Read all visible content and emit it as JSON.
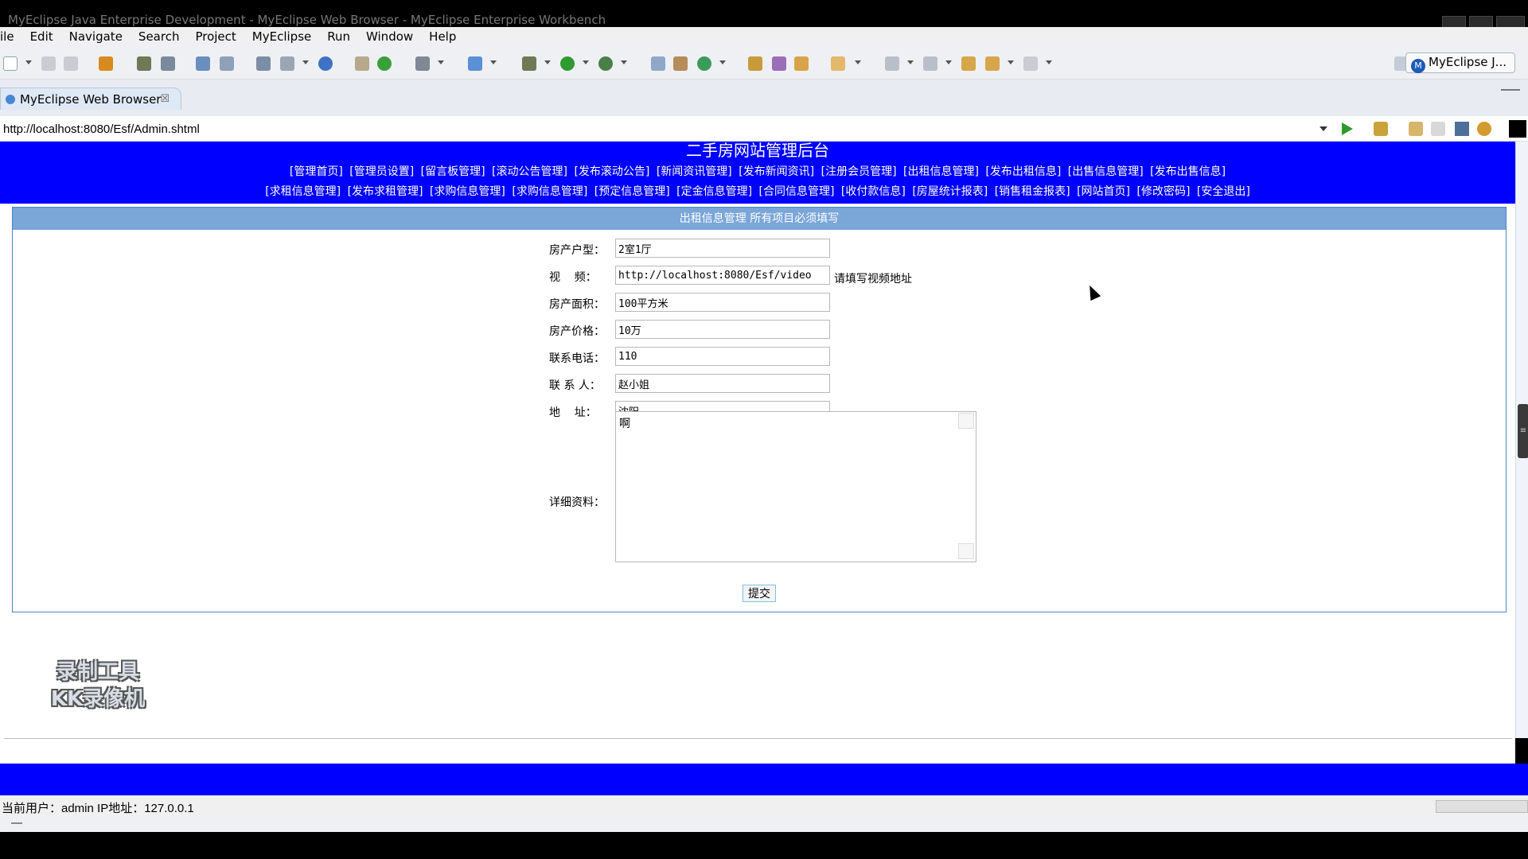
{
  "window": {
    "title": "MyEclipse Java Enterprise Development - MyEclipse Web Browser - MyEclipse Enterprise Workbench"
  },
  "menu": {
    "items": [
      "ile",
      "Edit",
      "Navigate",
      "Search",
      "Project",
      "MyEclipse",
      "Run",
      "Window",
      "Help"
    ]
  },
  "toolbar": {
    "perspective_label": "MyEclipse J..."
  },
  "editor_tab": {
    "label": "MyEclipse Web Browser",
    "close": "☒"
  },
  "address": {
    "url": "http://localhost:8080/Esf/Admin.shtml"
  },
  "site": {
    "title": "二手房网站管理后台",
    "nav_row1": [
      "[管理首页]",
      "[管理员设置]",
      "[留言板管理]",
      "[滚动公告管理]",
      "[发布滚动公告]",
      "[新闻资讯管理]",
      "[发布新闻资讯]",
      "[注册会员管理]",
      "[出租信息管理]",
      "[发布出租信息]",
      "[出售信息管理]",
      "[发布出售信息]"
    ],
    "nav_row2": [
      "[求租信息管理]",
      "[发布求租管理]",
      "[求购信息管理]",
      "[求购信息管理]",
      "[预定信息管理]",
      "[定金信息管理]",
      "[合同信息管理]",
      "[收付款信息]",
      "[房屋统计报表]",
      "[销售租金报表]",
      "[网站首页]",
      "[修改密码]",
      "[安全退出]"
    ]
  },
  "form": {
    "header": "出租信息管理 所有项目必须填写",
    "fields": [
      {
        "label": "房产户型：",
        "value": "2室1厅"
      },
      {
        "label": "视    频：",
        "value": "http://localhost:8080/Esf/video",
        "hint": "请填写视频地址"
      },
      {
        "label": "房产面积：",
        "value": "100平方米"
      },
      {
        "label": "房产价格：",
        "value": "10万"
      },
      {
        "label": "联系电话：",
        "value": "110"
      },
      {
        "label": "联 系 人：",
        "value": "赵小姐"
      },
      {
        "label": "地    址：",
        "value": "沈阳"
      }
    ],
    "detail_label": "详细资料：",
    "detail_value": "啊",
    "submit_label": "提交"
  },
  "watermark": {
    "line1": "录制工具",
    "line2": "KK录像机"
  },
  "status": {
    "text": "当前用户：admin  IP地址：127.0.0.1"
  },
  "colors": {
    "banner": "#0000ff",
    "panel_header": "#7aa6d8"
  }
}
